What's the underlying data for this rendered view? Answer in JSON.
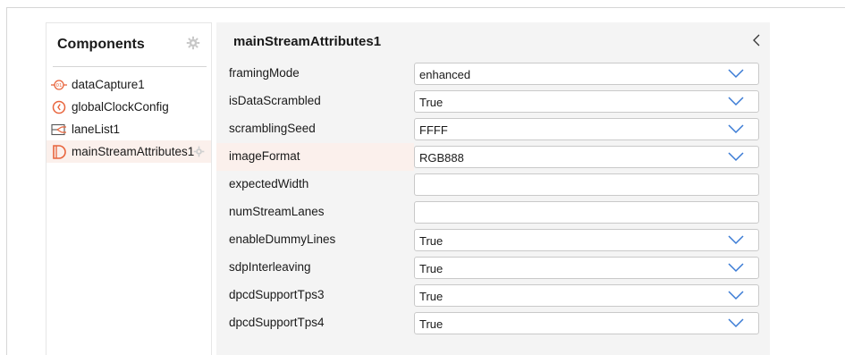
{
  "components_panel": {
    "title": "Components",
    "items": [
      {
        "label": "dataCapture1",
        "icon": "data-capture-icon"
      },
      {
        "label": "globalClockConfig",
        "icon": "clock-icon"
      },
      {
        "label": "laneList1",
        "icon": "lane-list-icon"
      },
      {
        "label": "mainStreamAttributes1",
        "icon": "stream-attributes-icon",
        "selected": true
      }
    ]
  },
  "attributes_panel": {
    "title": "mainStreamAttributes1",
    "rows": [
      {
        "label": "framingMode",
        "value": "enhanced",
        "dropdown": true
      },
      {
        "label": "isDataScrambled",
        "value": "True",
        "dropdown": true
      },
      {
        "label": "scramblingSeed",
        "value": "FFFF",
        "dropdown": true
      },
      {
        "label": "imageFormat",
        "value": "RGB888",
        "dropdown": true,
        "highlight": true
      },
      {
        "label": "expectedWidth",
        "value": "",
        "dropdown": false
      },
      {
        "label": "numStreamLanes",
        "value": "",
        "dropdown": false
      },
      {
        "label": "enableDummyLines",
        "value": "True",
        "dropdown": true
      },
      {
        "label": "sdpInterleaving",
        "value": "True",
        "dropdown": true
      },
      {
        "label": "dpcdSupportTps3",
        "value": "True",
        "dropdown": true
      },
      {
        "label": "dpcdSupportTps4",
        "value": "True",
        "dropdown": true
      }
    ]
  },
  "colors": {
    "accent": "#3a7bd5",
    "selected_bg": "#fbf0ec",
    "icon_orange": "#e8643c"
  }
}
